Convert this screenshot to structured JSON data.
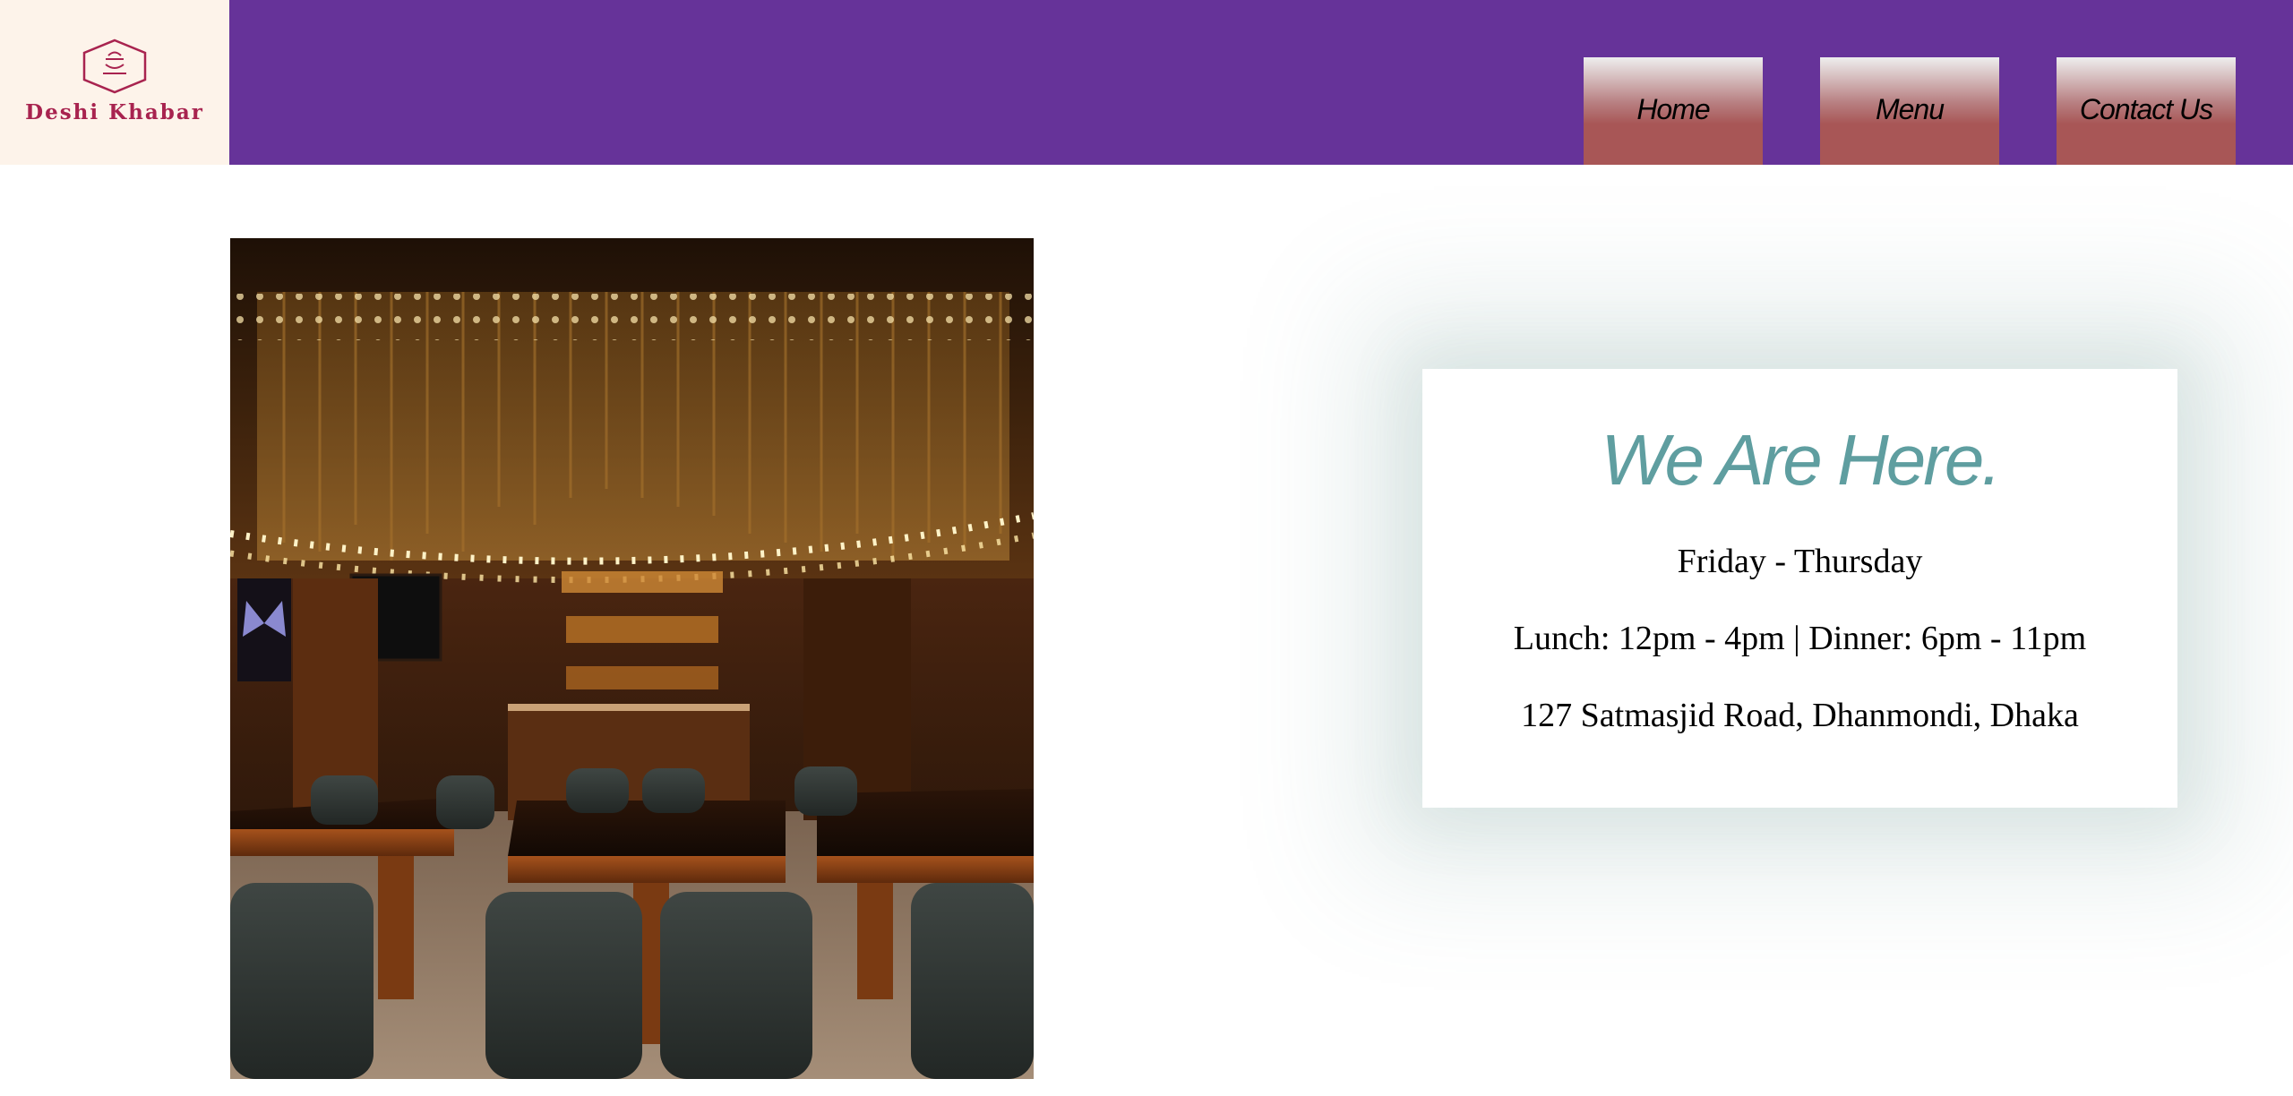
{
  "brand": {
    "name": "Deshi Khabar",
    "logo_icon": "hexagon-dish-icon",
    "color": "#a8234f"
  },
  "nav": {
    "items": [
      {
        "label": "Home"
      },
      {
        "label": "Menu"
      },
      {
        "label": "Contact Us"
      }
    ]
  },
  "colors": {
    "header_bg": "#663399",
    "logo_bg": "#fdf3ea",
    "title_accent": "#5f9ea0"
  },
  "photo": {
    "subject": "restaurant-interior-photo"
  },
  "info": {
    "title": "We Are Here.",
    "days": "Friday - Thursday",
    "hours": "Lunch: 12pm - 4pm | Dinner: 6pm - 11pm",
    "address": "127 Satmasjid Road, Dhanmondi, Dhaka"
  }
}
